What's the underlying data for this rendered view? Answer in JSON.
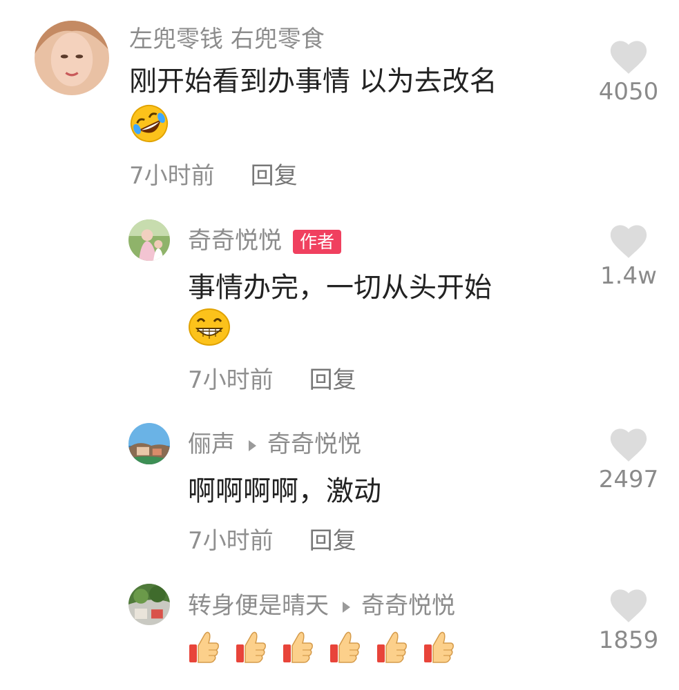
{
  "comments": [
    {
      "username": "左兜零钱 右兜零食",
      "text": "刚开始看到办事情 以为去改名",
      "emoji": "rolling-laughing-emoji",
      "time": "7小时前",
      "reply": "回复",
      "likes": "4050"
    },
    {
      "username": "奇奇悦悦",
      "badge": "作者",
      "text": "事情办完，一切从头开始",
      "emoji": "grinning-emoji",
      "time": "7小时前",
      "reply": "回复",
      "likes": "1.4w"
    },
    {
      "username": "俪声",
      "reply_to": "奇奇悦悦",
      "text": "啊啊啊啊，激动",
      "time": "7小时前",
      "reply": "回复",
      "likes": "2497"
    },
    {
      "username": "转身便是晴天",
      "reply_to": "奇奇悦悦",
      "emoji": "thumbs-up-emoji",
      "emoji_count": 6,
      "likes": "1859"
    }
  ],
  "colors": {
    "badge": "#f0405f",
    "username": "#8c8c8c",
    "text": "#222222",
    "heart": "#dcdcdc"
  }
}
